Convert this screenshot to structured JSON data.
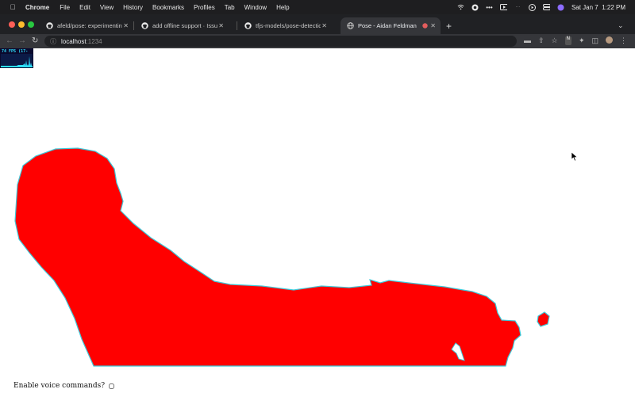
{
  "menubar": {
    "app": "Chrome",
    "items": [
      "File",
      "Edit",
      "View",
      "History",
      "Bookmarks",
      "Profiles",
      "Tab",
      "Window",
      "Help"
    ],
    "clock": "Sat Jan 7  1:22 PM"
  },
  "tabs": [
    {
      "label": "afeld/pose: experimenting wit",
      "icon": "github-icon"
    },
    {
      "label": "add offline support · Issue #16",
      "icon": "github-icon"
    },
    {
      "label": "tfjs-models/pose-detection at",
      "icon": "github-icon"
    },
    {
      "label": "Pose - Aidan Feldman",
      "icon": "globe-icon",
      "active": true
    }
  ],
  "address_bar": {
    "host": "localhost",
    "port": ":1234"
  },
  "page": {
    "fps_label": "74 FPS (17-96)",
    "voice_label": "Enable voice commands?",
    "voice_checked": false
  },
  "colors": {
    "segmentation_fill": "#ff0000",
    "segmentation_outline": "#3ec8d8"
  }
}
